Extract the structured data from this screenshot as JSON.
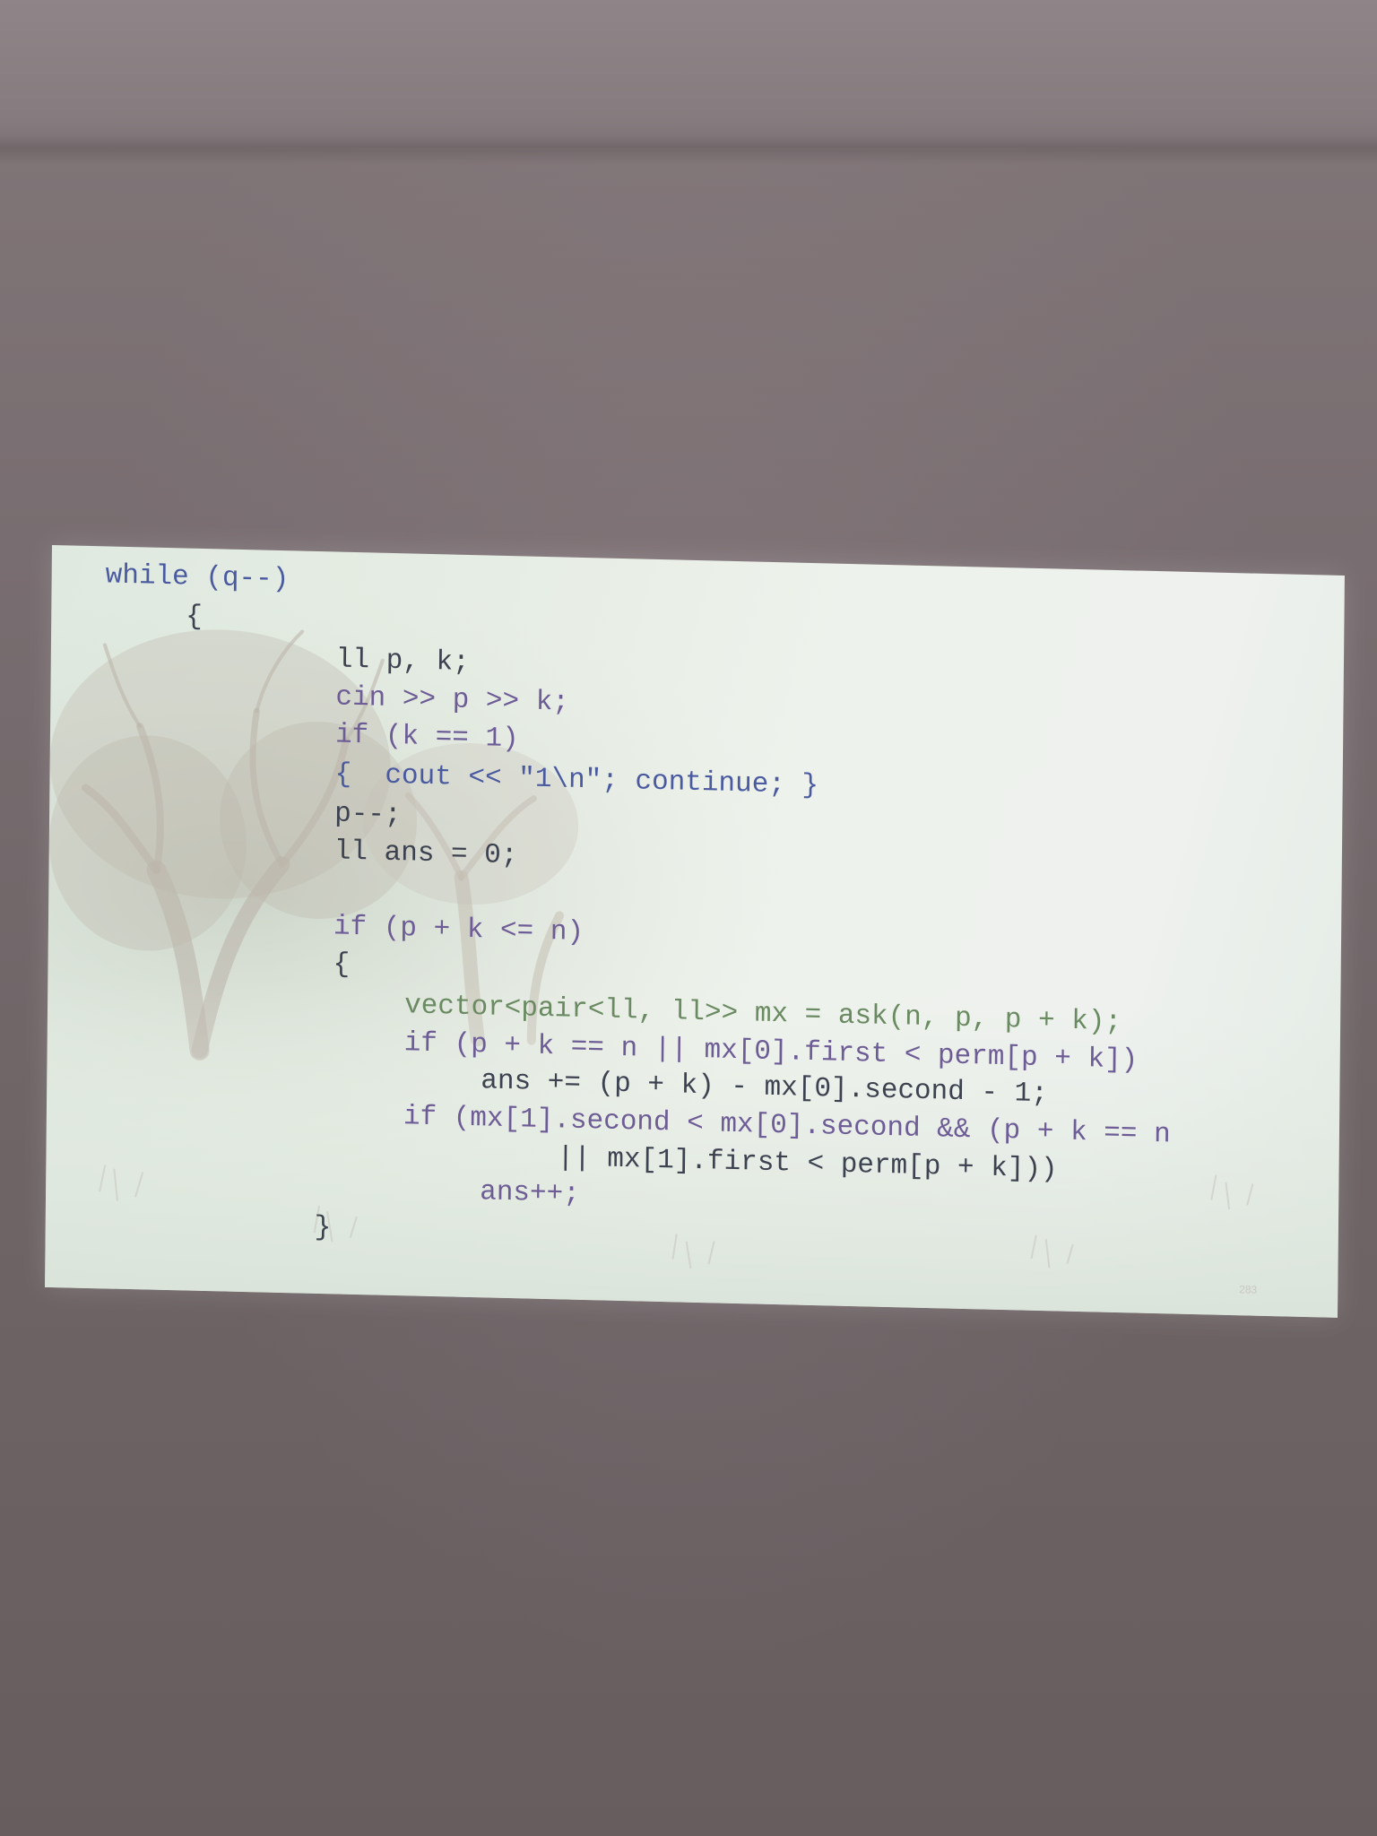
{
  "slide": {
    "code_lines": [
      "while (q--)",
      "{",
      "ll p, k;",
      "cin >> p >> k;",
      "if (k == 1)",
      "{  cout << \"1\\n\"; continue; }",
      "p--;",
      "ll ans = 0;",
      "if (p + k <= n)",
      "{",
      "vector<pair<ll, ll>> mx = ask(n, p, p + k);",
      "if (p + k == n || mx[0].first < perm[p + k])",
      "ans += (p + k) - mx[0].second - 1;",
      "if (mx[1].second < mx[0].second && (p + k == n",
      "|| mx[1].first < perm[p + k]))",
      "ans++;",
      "}"
    ],
    "page_number": "283"
  },
  "colors": {
    "screen_bg": "#e6ede4",
    "code_text": "#3f4553",
    "keyword_blue": "#4a5aa0",
    "room_wall": "#786d70"
  }
}
